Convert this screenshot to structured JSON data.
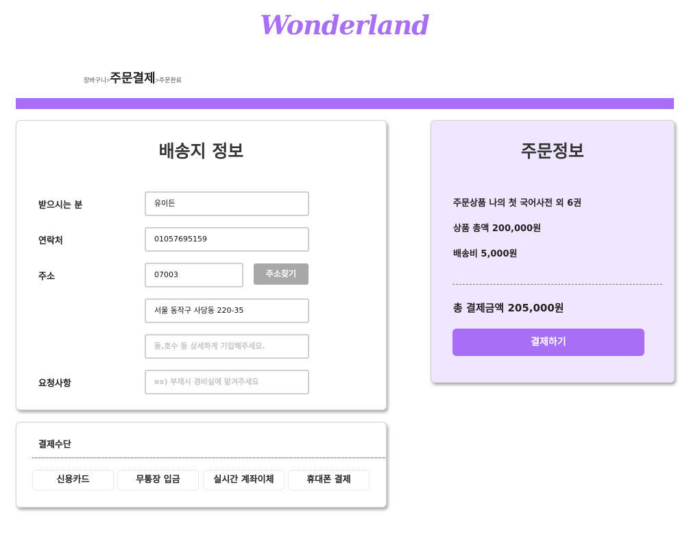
{
  "header": {
    "logo": "Wonderland"
  },
  "breadcrumb": {
    "prev": "장바구니>",
    "current": "주문결제",
    "next": ">주문완료"
  },
  "shipping": {
    "title": "배송지 정보",
    "recipient_label": "받으시는 분",
    "recipient_value": "유이든",
    "phone_label": "연락처",
    "phone_value": "01057695159",
    "address_label": "주소",
    "zipcode_value": "07003",
    "find_address_button": "주소찾기",
    "address_value": "서울 동작구 사당동 220-35",
    "address_detail_placeholder": "동,호수 등 상세하게 기입해주세요.",
    "request_label": "요청사항",
    "request_placeholder": "ex) 부재시 경비실에 맡겨주세요"
  },
  "payment": {
    "title": "결제수단",
    "methods": [
      "신용카드",
      "무통장 입금",
      "실시간 계좌이체",
      "휴대폰 결제"
    ]
  },
  "order": {
    "title": "주문정보",
    "product_line": "주문상품 나의 첫 국어사전 외 6권",
    "subtotal_line": "상품 총액 200,000원",
    "shipping_line": "배송비 5,000원",
    "total_line": "총 결제금액 205,000원",
    "pay_button": "결제하기"
  },
  "colors": {
    "accent": "#a86ef5",
    "order_bg": "#f1e6ff",
    "button_gray": "#a8a8a8"
  }
}
